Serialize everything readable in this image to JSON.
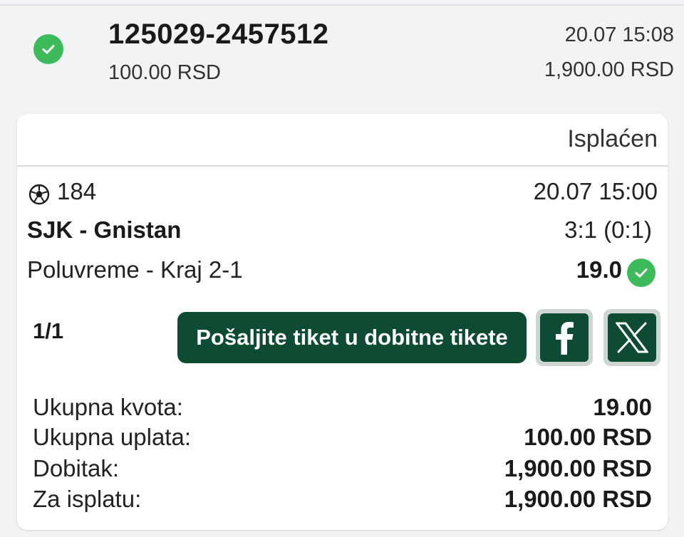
{
  "ticket": {
    "id": "125029-2457512",
    "stake": "100.00 RSD",
    "date": "20.07 15:08",
    "win_amount": "1,900.00 RSD"
  },
  "card": {
    "status": "Isplaćen",
    "event": {
      "sport_icon": "soccer-ball-icon",
      "code": "184",
      "datetime": "20.07 15:00",
      "match": "SJK - Gnistan",
      "score": "3:1 (0:1)",
      "bet": "Poluvreme - Kraj 2-1",
      "odds": "19.0"
    },
    "page_count": "1/1",
    "share_label": "Pošaljite tiket u dobitne tikete",
    "social": {
      "facebook_icon": "facebook-icon",
      "x_icon": "x-icon"
    },
    "summary": [
      {
        "label": "Ukupna kvota:",
        "value": "19.00"
      },
      {
        "label": "Ukupna uplata:",
        "value": "100.00 RSD"
      },
      {
        "label": "Dobitak:",
        "value": "1,900.00 RSD"
      },
      {
        "label": "Za isplatu:",
        "value": "1,900.00 RSD"
      }
    ]
  },
  "colors": {
    "background": "#f1f3f5",
    "success_green": "#3dbb5a",
    "brand_dark_green": "#0d4b33",
    "card_bg": "#ffffff"
  }
}
